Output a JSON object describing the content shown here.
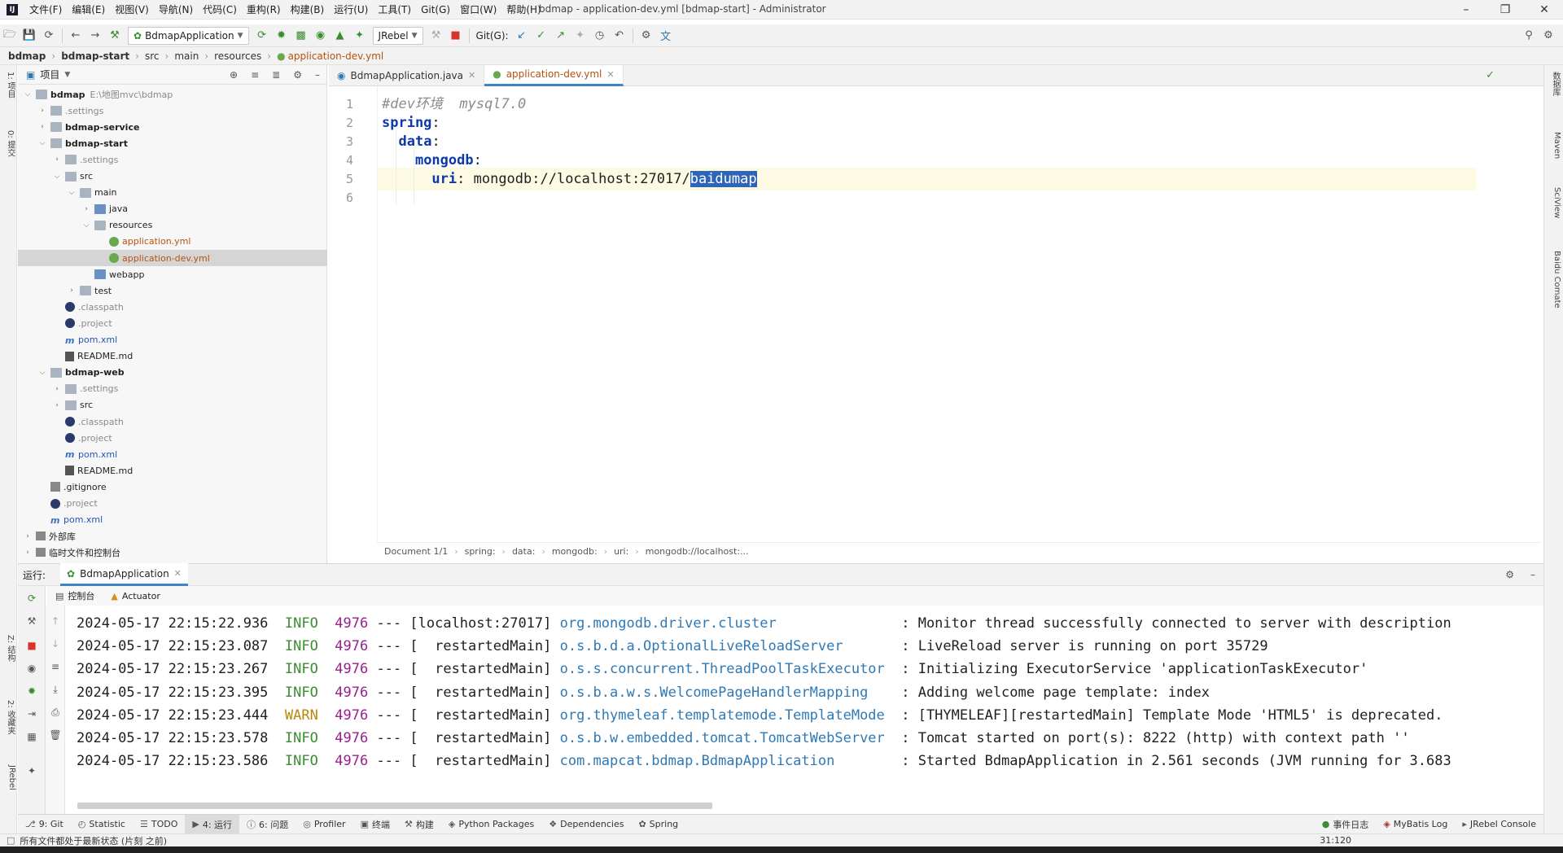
{
  "window": {
    "title": "bdmap - application-dev.yml [bdmap-start] - Administrator",
    "menu": [
      "文件(F)",
      "编辑(E)",
      "视图(V)",
      "导航(N)",
      "代码(C)",
      "重构(R)",
      "构建(B)",
      "运行(U)",
      "工具(T)",
      "Git(G)",
      "窗口(W)",
      "帮助(H)"
    ]
  },
  "toolbar": {
    "run_config": "BdmapApplication",
    "jrebel": "JRebel",
    "git_label": "Git(G):"
  },
  "breadcrumb": [
    "bdmap",
    "bdmap-start",
    "src",
    "main",
    "resources",
    "application-dev.yml"
  ],
  "project": {
    "header": "项目",
    "tree": [
      {
        "label": "bdmap",
        "path": "E:\\地图mvc\\bdmap",
        "depth": 0,
        "expanded": true,
        "icon": "folder-module",
        "style": "bold"
      },
      {
        "label": ".settings",
        "depth": 1,
        "expanded": false,
        "icon": "folder",
        "style": "grey"
      },
      {
        "label": "bdmap-service",
        "depth": 1,
        "expanded": false,
        "icon": "folder-module",
        "style": "bold"
      },
      {
        "label": "bdmap-start",
        "depth": 1,
        "expanded": true,
        "icon": "folder-module",
        "style": "bold"
      },
      {
        "label": ".settings",
        "depth": 2,
        "expanded": false,
        "icon": "folder",
        "style": "grey"
      },
      {
        "label": "src",
        "depth": 2,
        "expanded": true,
        "icon": "folder",
        "style": ""
      },
      {
        "label": "main",
        "depth": 3,
        "expanded": true,
        "icon": "folder",
        "style": ""
      },
      {
        "label": "java",
        "depth": 4,
        "expanded": false,
        "icon": "folder-blue",
        "style": ""
      },
      {
        "label": "resources",
        "depth": 4,
        "expanded": true,
        "icon": "folder",
        "style": ""
      },
      {
        "label": "application.yml",
        "depth": 5,
        "icon": "yml",
        "style": "orange"
      },
      {
        "label": "application-dev.yml",
        "depth": 5,
        "icon": "yml",
        "style": "orange",
        "selected": true
      },
      {
        "label": "webapp",
        "depth": 4,
        "icon": "folder-blue",
        "style": ""
      },
      {
        "label": "test",
        "depth": 3,
        "expanded": false,
        "icon": "folder",
        "style": ""
      },
      {
        "label": ".classpath",
        "depth": 2,
        "icon": "eclipse",
        "style": "grey"
      },
      {
        "label": ".project",
        "depth": 2,
        "icon": "eclipse",
        "style": "grey"
      },
      {
        "label": "pom.xml",
        "depth": 2,
        "icon": "maven",
        "style": "blue"
      },
      {
        "label": "README.md",
        "depth": 2,
        "icon": "md",
        "style": ""
      },
      {
        "label": "bdmap-web",
        "depth": 1,
        "expanded": true,
        "icon": "folder-module",
        "style": "bold"
      },
      {
        "label": ".settings",
        "depth": 2,
        "expanded": false,
        "icon": "folder",
        "style": "grey"
      },
      {
        "label": "src",
        "depth": 2,
        "expanded": false,
        "icon": "folder",
        "style": ""
      },
      {
        "label": ".classpath",
        "depth": 2,
        "icon": "eclipse",
        "style": "grey"
      },
      {
        "label": ".project",
        "depth": 2,
        "icon": "eclipse",
        "style": "grey"
      },
      {
        "label": "pom.xml",
        "depth": 2,
        "icon": "maven",
        "style": "blue"
      },
      {
        "label": "README.md",
        "depth": 2,
        "icon": "md",
        "style": ""
      },
      {
        "label": ".gitignore",
        "depth": 1,
        "icon": "git",
        "style": ""
      },
      {
        "label": ".project",
        "depth": 1,
        "icon": "eclipse",
        "style": "grey"
      },
      {
        "label": "pom.xml",
        "depth": 1,
        "icon": "maven",
        "style": "blue"
      },
      {
        "label": "外部库",
        "depth": 0,
        "expanded": false,
        "icon": "lib",
        "style": ""
      },
      {
        "label": "临时文件和控制台",
        "depth": 0,
        "expanded": false,
        "icon": "lib",
        "style": ""
      }
    ]
  },
  "editor": {
    "tabs": [
      {
        "label": "BdmapApplication.java",
        "active": false
      },
      {
        "label": "application-dev.yml",
        "active": true
      }
    ],
    "lines": [
      {
        "num": "1",
        "parts": [
          {
            "t": "#dev环境  mysql7.0",
            "c": "comment"
          }
        ]
      },
      {
        "num": "2",
        "parts": [
          {
            "t": "spring",
            "c": "key"
          },
          {
            "t": ":",
            "c": "val"
          }
        ]
      },
      {
        "num": "3",
        "parts": [
          {
            "t": "  ",
            "c": "val"
          },
          {
            "t": "data",
            "c": "key"
          },
          {
            "t": ":",
            "c": "val"
          }
        ]
      },
      {
        "num": "4",
        "parts": [
          {
            "t": "    ",
            "c": "val"
          },
          {
            "t": "mongodb",
            "c": "key"
          },
          {
            "t": ":",
            "c": "val"
          }
        ]
      },
      {
        "num": "5",
        "parts": [
          {
            "t": "      ",
            "c": "val"
          },
          {
            "t": "uri",
            "c": "key"
          },
          {
            "t": ": mongodb://localhost:27017/",
            "c": "val"
          },
          {
            "t": "baidumap",
            "c": "sel"
          }
        ]
      },
      {
        "num": "6",
        "parts": []
      }
    ],
    "status_path": [
      "Document 1/1",
      "spring:",
      "data:",
      "mongodb:",
      "uri:",
      "mongodb://localhost:..."
    ]
  },
  "run": {
    "label": "运行:",
    "tab": "BdmapApplication",
    "subtabs": [
      "控制台",
      "Actuator"
    ],
    "console": [
      {
        "time": "2024-05-17 22:15:22.936",
        "level": "INFO",
        "pid": "4976",
        "thread": "[localhost:27017]",
        "logger": "org.mongodb.driver.cluster",
        "msg": ": Monitor thread successfully connected to server with description"
      },
      {
        "time": "2024-05-17 22:15:23.087",
        "level": "INFO",
        "pid": "4976",
        "thread": "[  restartedMain]",
        "logger": "o.s.b.d.a.OptionalLiveReloadServer",
        "msg": ": LiveReload server is running on port 35729"
      },
      {
        "time": "2024-05-17 22:15:23.267",
        "level": "INFO",
        "pid": "4976",
        "thread": "[  restartedMain]",
        "logger": "o.s.s.concurrent.ThreadPoolTaskExecutor",
        "msg": ": Initializing ExecutorService 'applicationTaskExecutor'"
      },
      {
        "time": "2024-05-17 22:15:23.395",
        "level": "INFO",
        "pid": "4976",
        "thread": "[  restartedMain]",
        "logger": "o.s.b.a.w.s.WelcomePageHandlerMapping",
        "msg": ": Adding welcome page template: index"
      },
      {
        "time": "2024-05-17 22:15:23.444",
        "level": "WARN",
        "pid": "4976",
        "thread": "[  restartedMain]",
        "logger": "org.thymeleaf.templatemode.TemplateMode",
        "msg": ": [THYMELEAF][restartedMain] Template Mode 'HTML5' is deprecated."
      },
      {
        "time": "2024-05-17 22:15:23.578",
        "level": "INFO",
        "pid": "4976",
        "thread": "[  restartedMain]",
        "logger": "o.s.b.w.embedded.tomcat.TomcatWebServer",
        "msg": ": Tomcat started on port(s): 8222 (http) with context path ''"
      },
      {
        "time": "2024-05-17 22:15:23.586",
        "level": "INFO",
        "pid": "4976",
        "thread": "[  restartedMain]",
        "logger": "com.mapcat.bdmap.BdmapApplication",
        "msg": ": Started BdmapApplication in 2.561 seconds (JVM running for 3.683"
      }
    ]
  },
  "bottom_tabs": [
    {
      "label": "9: Git",
      "icon": "git-branch-icon",
      "active": false
    },
    {
      "label": "Statistic",
      "icon": "statistic-icon",
      "active": false
    },
    {
      "label": "TODO",
      "icon": "todo-icon",
      "active": false
    },
    {
      "label": "4: 运行",
      "icon": "run-icon",
      "active": true
    },
    {
      "label": "6: 问题",
      "icon": "problems-icon",
      "active": false
    },
    {
      "label": "Profiler",
      "icon": "profiler-icon",
      "active": false
    },
    {
      "label": "终端",
      "icon": "terminal-icon",
      "active": false
    },
    {
      "label": "构建",
      "icon": "build-icon",
      "active": false
    },
    {
      "label": "Python Packages",
      "icon": "python-packages-icon",
      "active": false
    },
    {
      "label": "Dependencies",
      "icon": "dependencies-icon",
      "active": false
    },
    {
      "label": "Spring",
      "icon": "spring-icon",
      "active": false
    }
  ],
  "bottom_right_tabs": [
    "事件日志",
    "MyBatis Log",
    "JRebel Console"
  ],
  "status": {
    "message": "所有文件都处于最新状态 (片刻 之前)",
    "position": "31:120"
  },
  "side_tabs": {
    "left": [
      "1: 项目",
      "0: 提交",
      "Z: 结构",
      "2: 收藏夹",
      "JRebel"
    ],
    "right": [
      "数据库",
      "Maven",
      "SciView",
      "Baidu Comate"
    ]
  }
}
